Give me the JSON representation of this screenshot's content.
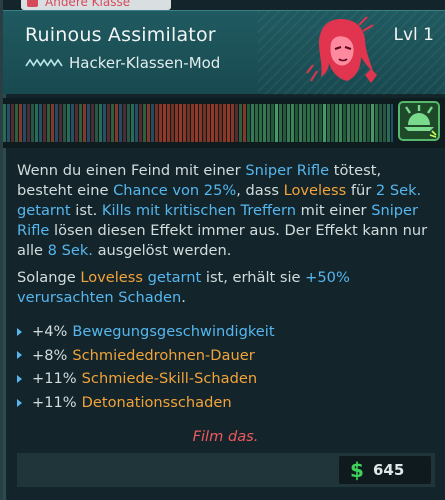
{
  "header": {
    "category_tag": "Andere Klasse",
    "title": "Ruinous Assimilator",
    "subtitle": "Hacker-Klassen-Mod",
    "level": "Lvl 1"
  },
  "description": {
    "p1": [
      {
        "text": "Wenn du einen Feind mit einer ",
        "style": "plain"
      },
      {
        "text": "Sniper Rifle",
        "style": "blue"
      },
      {
        "text": " tötest, besteht eine ",
        "style": "plain"
      },
      {
        "text": "Chance von 25%",
        "style": "blue"
      },
      {
        "text": ", dass ",
        "style": "plain"
      },
      {
        "text": "Loveless",
        "style": "orange"
      },
      {
        "text": " für ",
        "style": "plain"
      },
      {
        "text": "2 Sek.",
        "style": "blue"
      },
      {
        "text": " ",
        "style": "plain"
      },
      {
        "text": "getarnt",
        "style": "blue"
      },
      {
        "text": " ist. ",
        "style": "plain"
      },
      {
        "text": "Kills mit kritischen Treffern",
        "style": "blue"
      },
      {
        "text": " mit einer ",
        "style": "plain"
      },
      {
        "text": "Sniper Rifle",
        "style": "blue"
      },
      {
        "text": " lösen diesen Effekt immer aus. Der Effekt kann nur alle ",
        "style": "plain"
      },
      {
        "text": "8 Sek.",
        "style": "blue"
      },
      {
        "text": " ausgelöst werden.",
        "style": "plain"
      }
    ],
    "p2": [
      {
        "text": "Solange ",
        "style": "plain"
      },
      {
        "text": "Loveless",
        "style": "orange"
      },
      {
        "text": " ",
        "style": "plain"
      },
      {
        "text": "getarnt",
        "style": "blue"
      },
      {
        "text": " ist, erhält sie ",
        "style": "plain"
      },
      {
        "text": "+50% verursachten Schaden",
        "style": "blue"
      },
      {
        "text": ".",
        "style": "plain"
      }
    ]
  },
  "stats": [
    {
      "value": "+4%",
      "label": "Bewegungsgeschwindigkeit",
      "color": "blue"
    },
    {
      "value": "+8%",
      "label": "Schmiededrohnen-Dauer",
      "color": "orange"
    },
    {
      "value": "+11%",
      "label": "Schmiede-Skill-Schaden",
      "color": "orange"
    },
    {
      "value": "+11%",
      "label": "Detonationsschaden",
      "color": "orange"
    }
  ],
  "flavor_text": "Film das.",
  "price": {
    "currency_icon": "dollar-icon",
    "amount": "645"
  },
  "icons": {
    "category": "class-mod-icon",
    "subtitle": "hacker-chevrons-icon",
    "portrait": "loveless-portrait-icon",
    "skill": "drone-skill-icon"
  },
  "colors": {
    "header_bg": "#1f5a60",
    "body_bg": "#13252a",
    "highlight_blue": "#56b6ef",
    "highlight_orange": "#f2a33a",
    "flavor_red": "#f0585f",
    "price_green": "#3fd35a"
  }
}
